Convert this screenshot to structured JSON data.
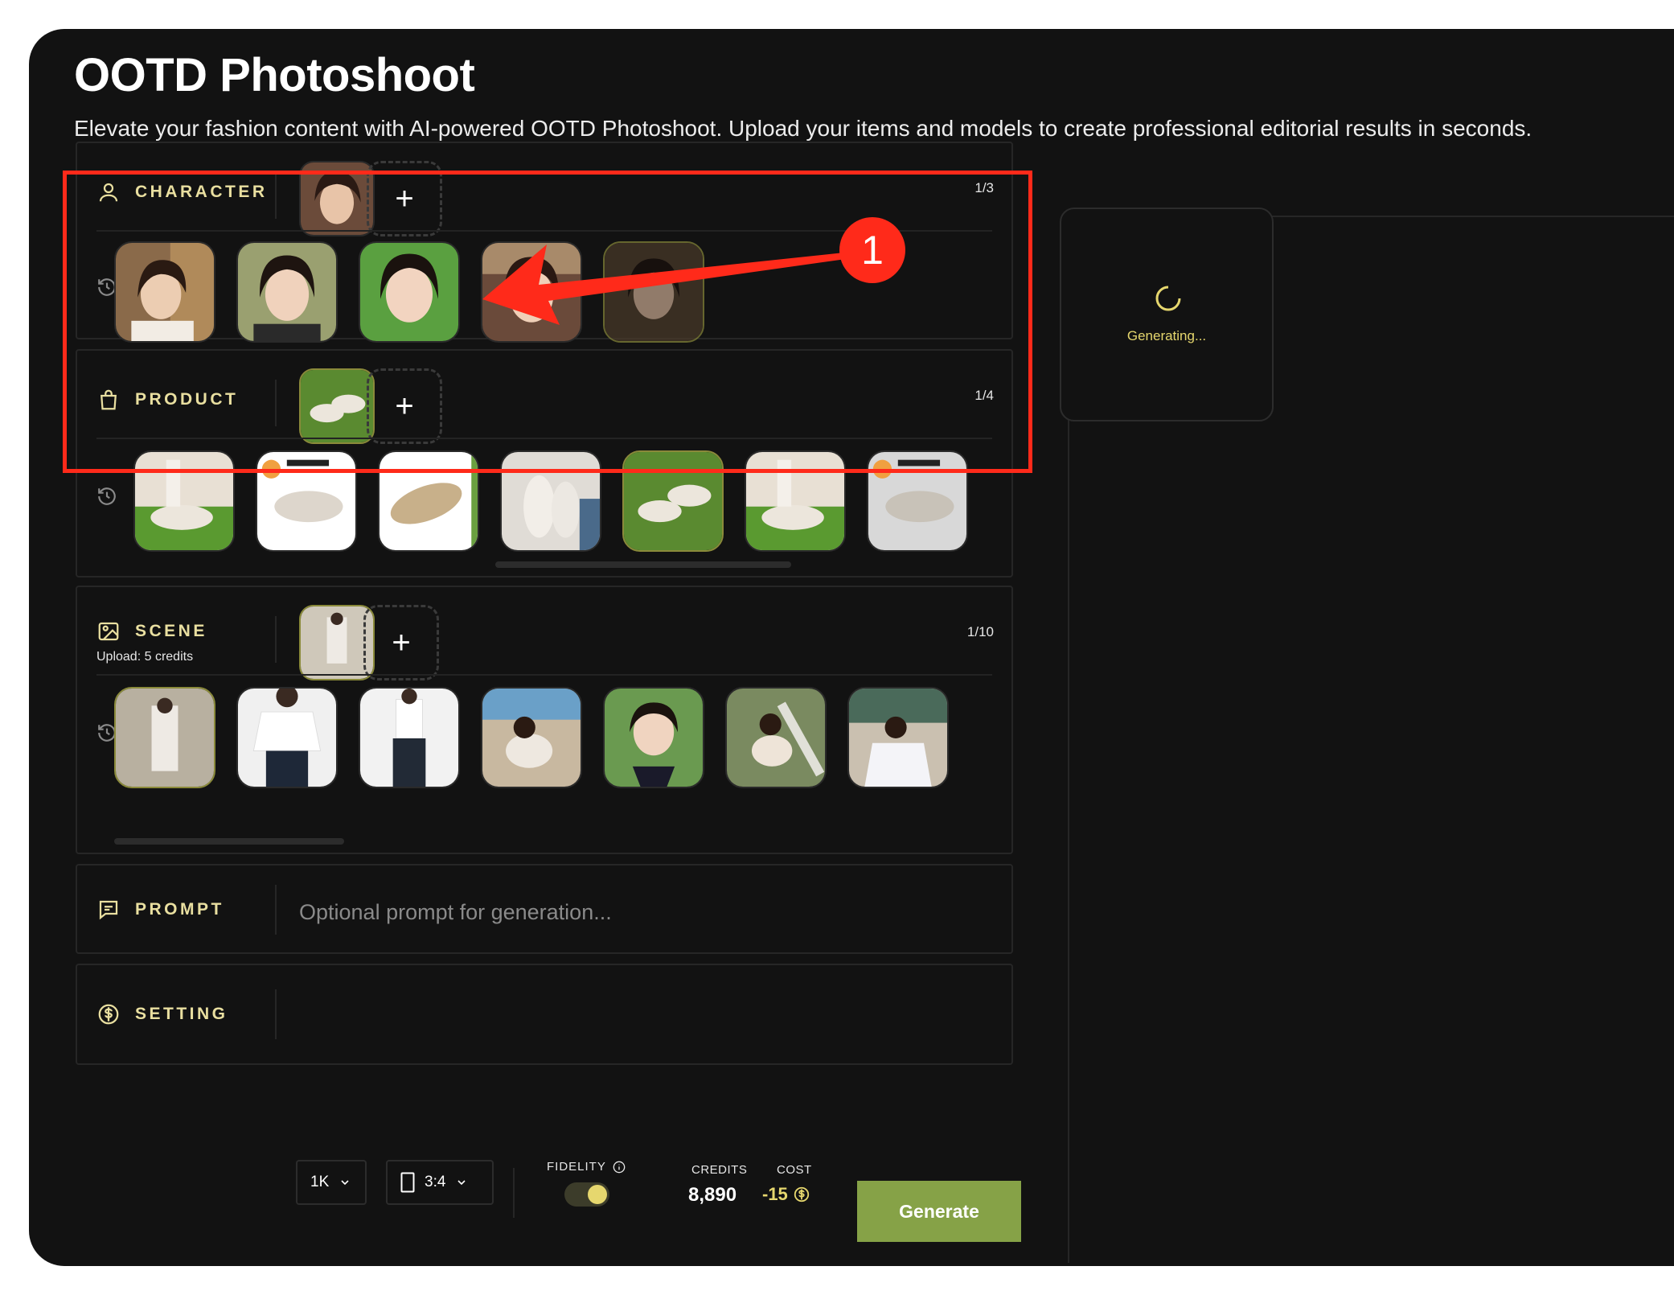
{
  "app": {
    "title": "OOTD Photoshoot",
    "subtitle": "Elevate your fashion content with AI-powered OOTD Photoshoot. Upload your items and models to create professional editorial results in seconds."
  },
  "character": {
    "label": "CHARACTER",
    "counter": "1/3",
    "icon": "person-icon",
    "history_count": 5
  },
  "product": {
    "label": "PRODUCT",
    "counter": "1/4",
    "icon": "shopping-bag-icon",
    "history_count": 7
  },
  "scene": {
    "label": "SCENE",
    "note": "Upload: 5 credits",
    "counter": "1/10",
    "icon": "image-icon",
    "history_count": 7
  },
  "prompt": {
    "label": "PROMPT",
    "placeholder": "Optional prompt for generation...",
    "value": "",
    "icon": "chat-icon"
  },
  "setting": {
    "label": "SETTING",
    "icon": "dollar-circle-icon",
    "resolution": "1K",
    "aspect_ratio": "3:4",
    "fidelity_label": "FIDELITY",
    "fidelity_on": true,
    "credits_label": "CREDITS",
    "credits_value": "8,890",
    "cost_label": "COST",
    "cost_value": "-15",
    "generate_label": "Generate"
  },
  "output": {
    "status": "Generating..."
  },
  "annotation": {
    "badge": "1"
  },
  "colors": {
    "accent": "#e9dfa0",
    "generate": "#86a247",
    "annotation": "#ff2a1a",
    "background": "#121212"
  }
}
